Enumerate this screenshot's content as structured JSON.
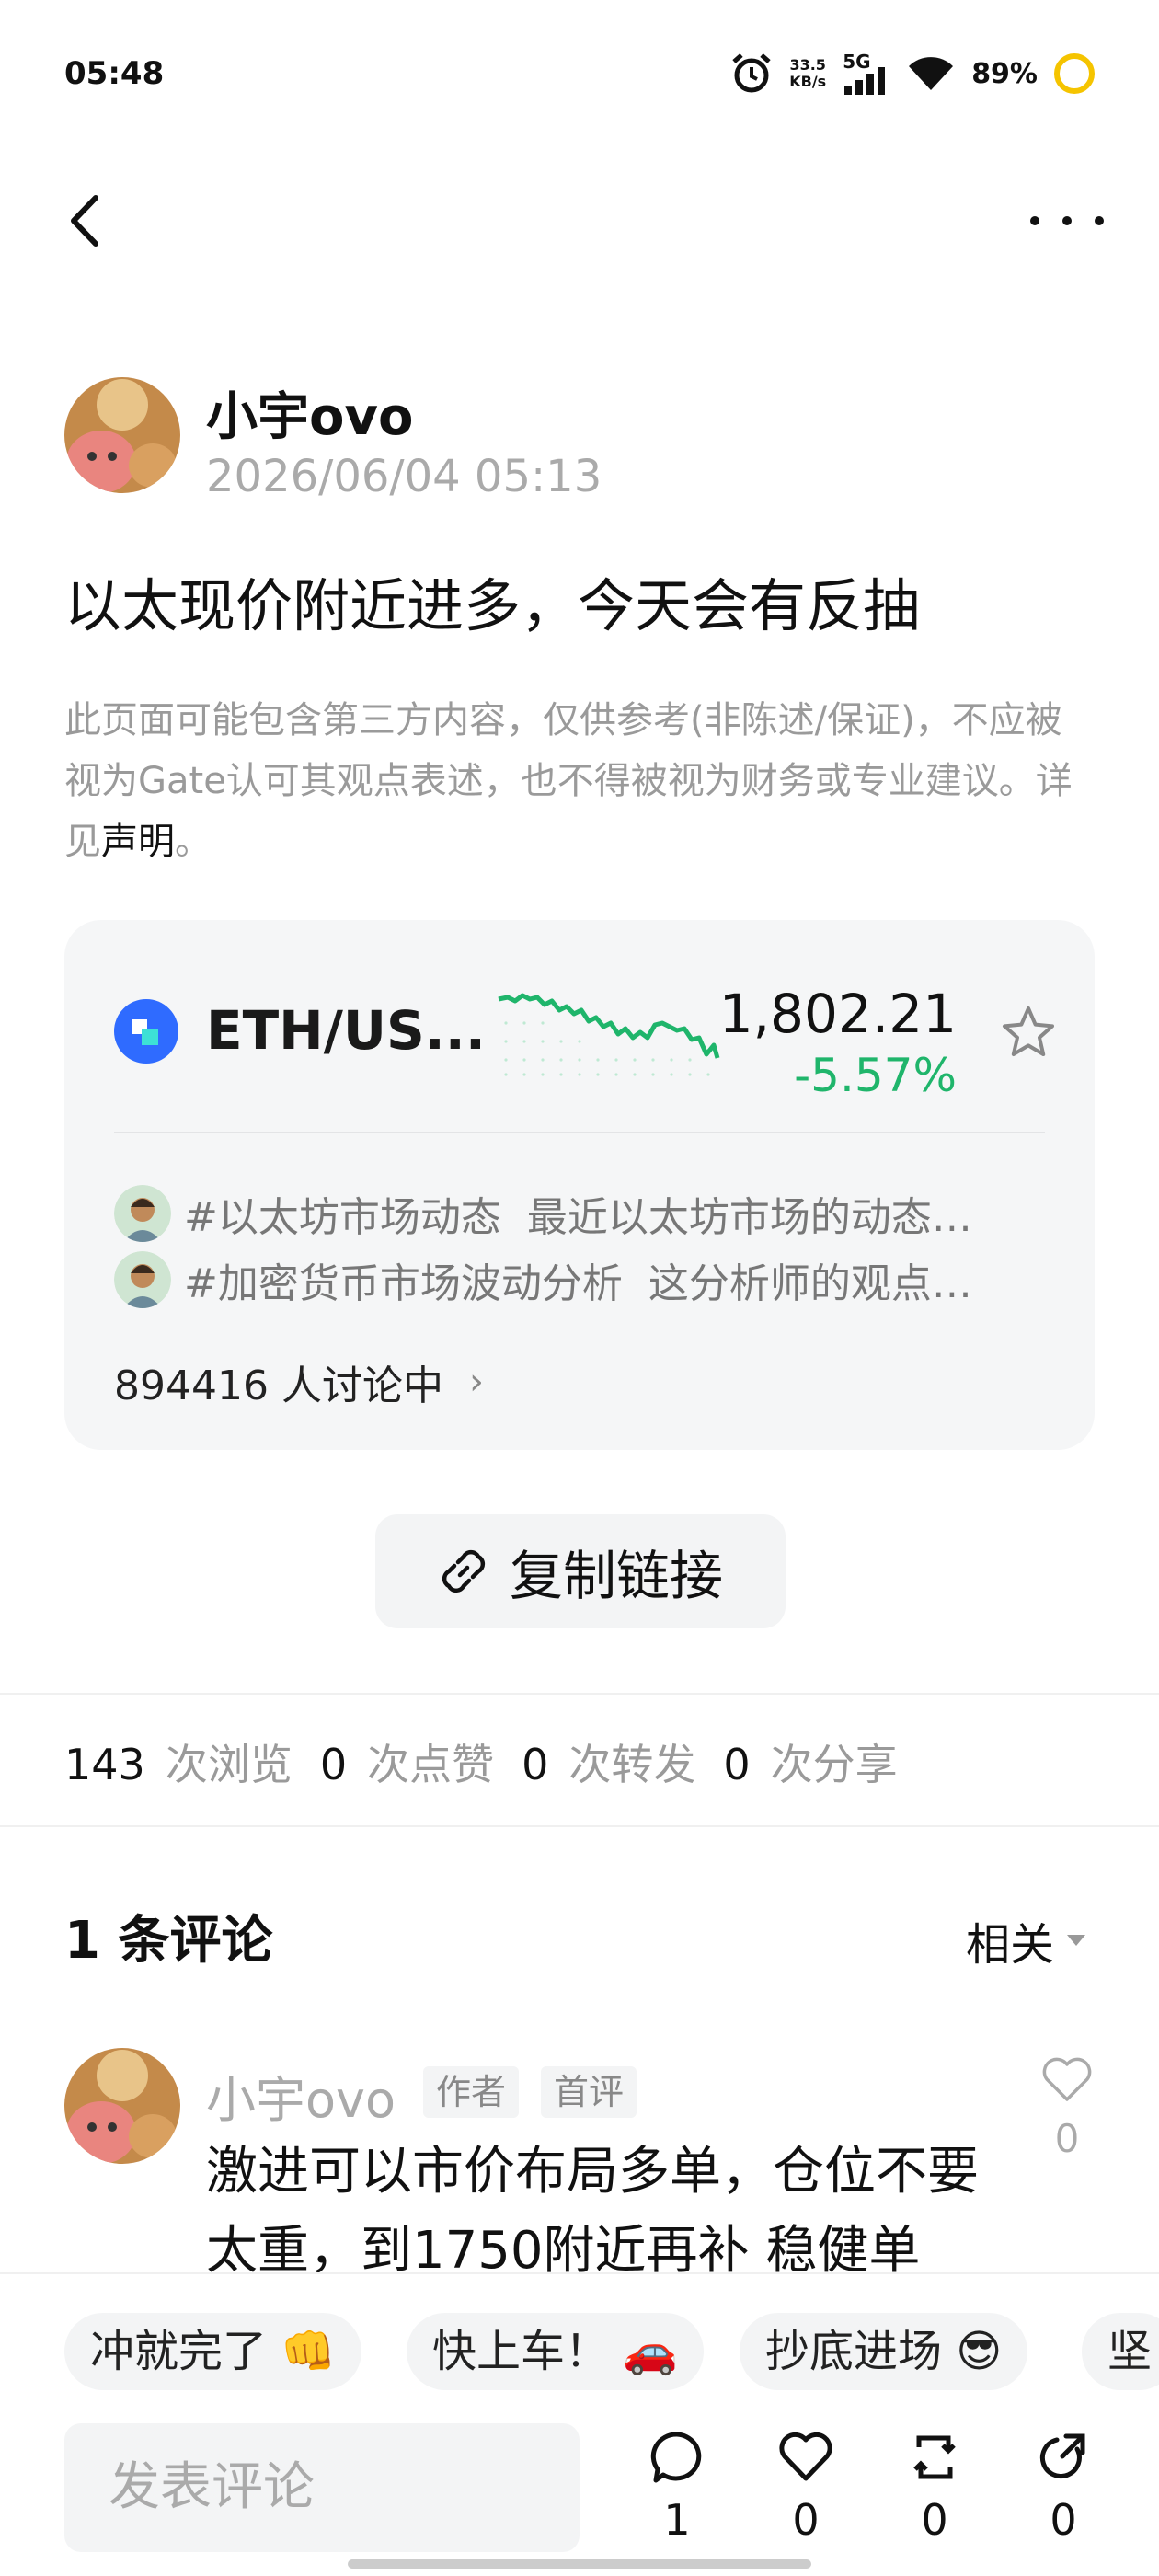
{
  "status_bar": {
    "time": "05:48",
    "speed_value": "33.5",
    "speed_unit": "KB/s",
    "network": "5G",
    "battery": "89%"
  },
  "post": {
    "author": "小宇ovo",
    "time": "2026/06/04 05:13",
    "title": "以太现价附近进多，今天会有反抽",
    "disclaimer": "此页面可能包含第三方内容，仅供参考(非陈述/保证)，不应被视为Gate认可其观点表述，也不得被视为财务或专业建议。详见",
    "disclaimer_link": "声明",
    "disclaimer_end": "。"
  },
  "market": {
    "pair": "ETH/US...",
    "price": "1,802.21",
    "change": "-5.57%",
    "change_color": "#1fb56b",
    "topics": [
      {
        "tag": "#以太坊市场动态",
        "summary": "最近以太坊市场的动态…"
      },
      {
        "tag": "#加密货币市场波动分析",
        "summary": "这分析师的观点…"
      }
    ],
    "discussing_count": "894416",
    "discussing_label": "人讨论中"
  },
  "copy_link": {
    "label": "复制链接"
  },
  "stats": {
    "views": "143",
    "views_label": "次浏览",
    "likes": "0",
    "likes_label": "次点赞",
    "reposts": "0",
    "reposts_label": "次转发",
    "shares": "0",
    "shares_label": "次分享"
  },
  "comments": {
    "count_label": "1 条评论",
    "sort_label": "相关",
    "items": [
      {
        "author": "小宇ovo",
        "badges": [
          "作者",
          "首评"
        ],
        "text": "激进可以市价布局多单，仓位不要太重，到1750附近再补 稳健单",
        "likes": "0"
      }
    ]
  },
  "quick_replies": [
    "冲就完了 👊",
    "快上车！ 🚗",
    "抄底进场 😎",
    "坚"
  ],
  "bottom": {
    "input_placeholder": "发表评论",
    "comment_count": "1",
    "like_count": "0",
    "repost_count": "0",
    "share_count": "0"
  }
}
